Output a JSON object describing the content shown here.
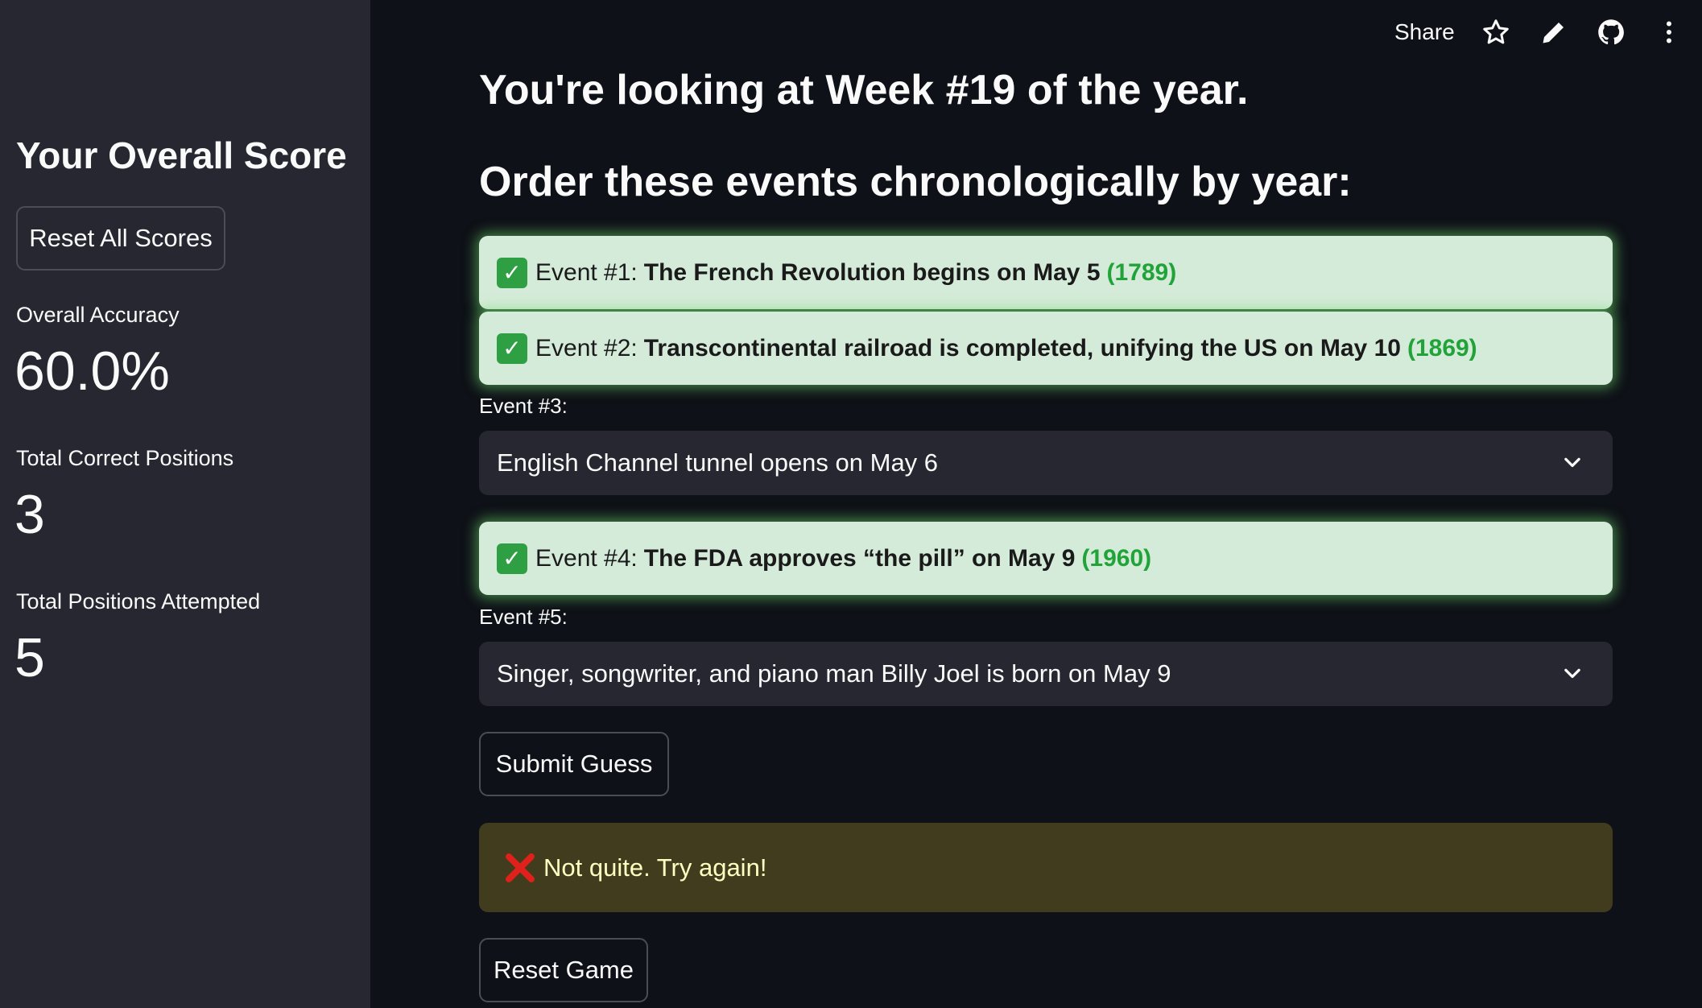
{
  "header": {
    "share_label": "Share",
    "icons": [
      "star-icon",
      "pencil-icon",
      "github-icon",
      "more-vertical-icon"
    ]
  },
  "sidebar": {
    "title": "Your Overall Score",
    "reset_all_label": "Reset All Scores",
    "metrics": [
      {
        "label": "Overall Accuracy",
        "value": "60.0%"
      },
      {
        "label": "Total Correct Positions",
        "value": "3"
      },
      {
        "label": "Total Positions Attempted",
        "value": "5"
      }
    ]
  },
  "main": {
    "week_heading": "You're looking at Week #19 of the year.",
    "instruction_heading": "Order these events chronologically by year:",
    "events": [
      {
        "prefix": "Event #1:",
        "text": "The French Revolution begins on May 5",
        "year": "(1789)"
      },
      {
        "prefix": "Event #2:",
        "text": "Transcontinental railroad is completed, unifying the US on May 10",
        "year": "(1869)"
      },
      {
        "label": "Event #3:",
        "selected": "English Channel tunnel opens on May 6"
      },
      {
        "prefix": "Event #4:",
        "text": "The FDA approves “the pill” on May 9",
        "year": "(1960)"
      },
      {
        "label": "Event #5:",
        "selected": "Singer, songwriter, and piano man Billy Joel is born on May 9"
      }
    ],
    "submit_label": "Submit Guess",
    "alert_text": "Not quite. Try again!",
    "reset_game_label": "Reset Game"
  },
  "colors": {
    "background": "#0e1117",
    "sidebar": "#262730",
    "correct_bg": "#d5ebd9",
    "year_green": "#21a33a",
    "warning_bg": "#423c1f",
    "warning_text": "#ffffc2"
  }
}
